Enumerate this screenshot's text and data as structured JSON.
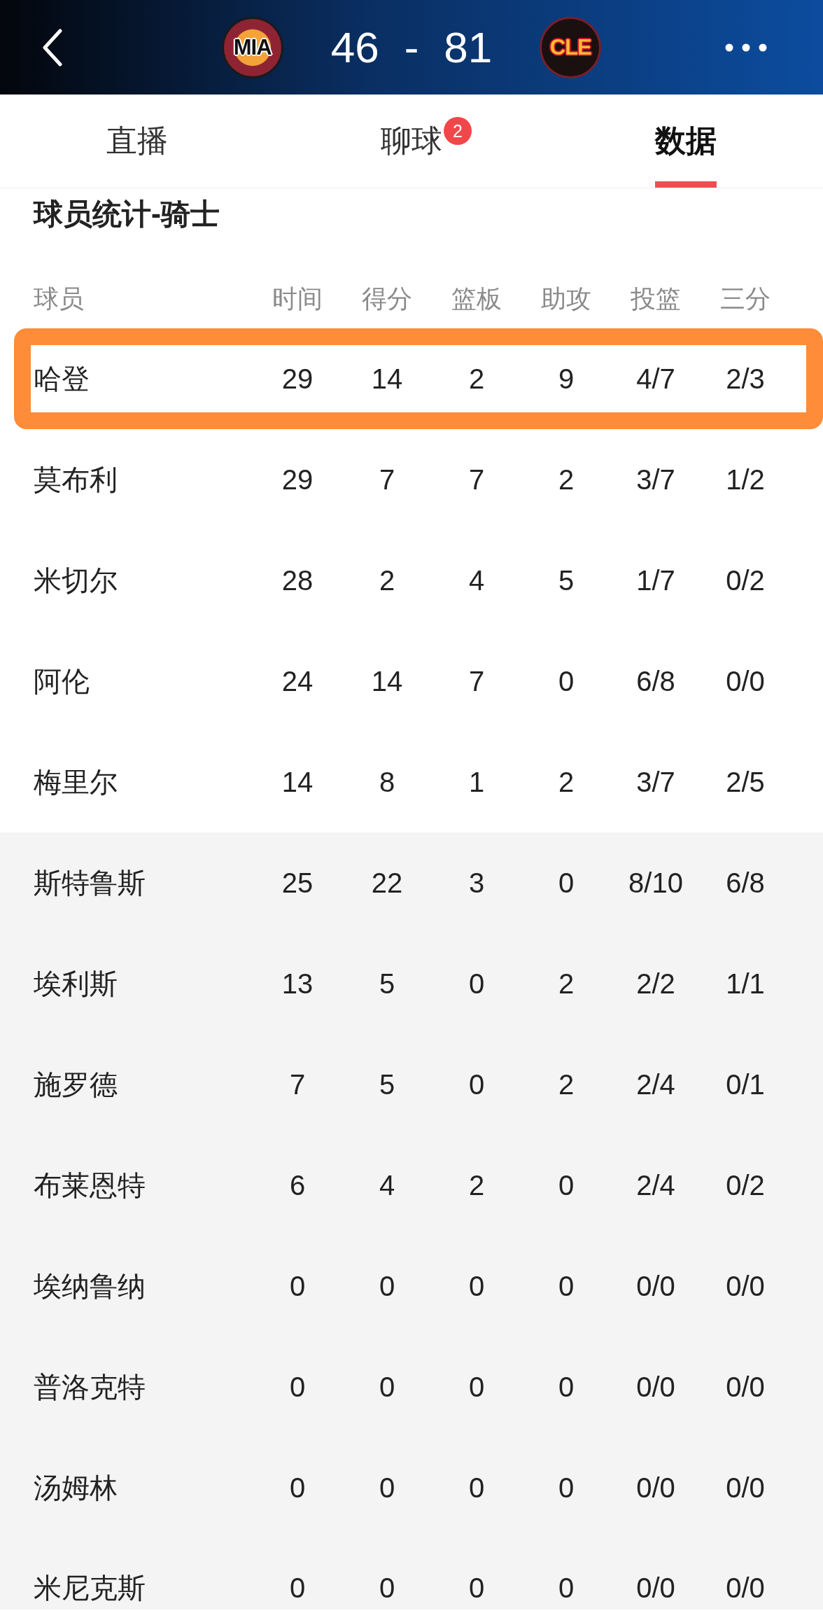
{
  "header": {
    "home": {
      "abbr": "MIA"
    },
    "score": {
      "home": "46",
      "separator": "-",
      "away": "81"
    },
    "away": {
      "abbr": "CLE"
    }
  },
  "tabs": [
    {
      "label": "直播",
      "selected": false
    },
    {
      "label": "聊球",
      "selected": false,
      "badge": "2"
    },
    {
      "label": "数据",
      "selected": true
    }
  ],
  "section": {
    "title": "球员统计-骑士"
  },
  "table": {
    "columns": [
      "球员",
      "时间",
      "得分",
      "篮板",
      "助攻",
      "投篮",
      "三分"
    ],
    "groups": [
      {
        "kind": "starters",
        "rows": [
          {
            "name": "哈登",
            "stats": [
              "29",
              "14",
              "2",
              "9",
              "4/7",
              "2/3"
            ],
            "highlighted": true
          },
          {
            "name": "莫布利",
            "stats": [
              "29",
              "7",
              "7",
              "2",
              "3/7",
              "1/2"
            ],
            "highlighted": false
          },
          {
            "name": "米切尔",
            "stats": [
              "28",
              "2",
              "4",
              "5",
              "1/7",
              "0/2"
            ],
            "highlighted": false
          },
          {
            "name": "阿伦",
            "stats": [
              "24",
              "14",
              "7",
              "0",
              "6/8",
              "0/0"
            ],
            "highlighted": false
          },
          {
            "name": "梅里尔",
            "stats": [
              "14",
              "8",
              "1",
              "2",
              "3/7",
              "2/5"
            ],
            "highlighted": false
          }
        ]
      },
      {
        "kind": "bench",
        "rows": [
          {
            "name": "斯特鲁斯",
            "stats": [
              "25",
              "22",
              "3",
              "0",
              "8/10",
              "6/8"
            ],
            "highlighted": false
          },
          {
            "name": "埃利斯",
            "stats": [
              "13",
              "5",
              "0",
              "2",
              "2/2",
              "1/1"
            ],
            "highlighted": false
          },
          {
            "name": "施罗德",
            "stats": [
              "7",
              "5",
              "0",
              "2",
              "2/4",
              "0/1"
            ],
            "highlighted": false
          },
          {
            "name": "布莱恩特",
            "stats": [
              "6",
              "4",
              "2",
              "0",
              "2/4",
              "0/2"
            ],
            "highlighted": false
          },
          {
            "name": "埃纳鲁纳",
            "stats": [
              "0",
              "0",
              "0",
              "0",
              "0/0",
              "0/0"
            ],
            "highlighted": false
          },
          {
            "name": "普洛克特",
            "stats": [
              "0",
              "0",
              "0",
              "0",
              "0/0",
              "0/0"
            ],
            "highlighted": false
          },
          {
            "name": "汤姆林",
            "stats": [
              "0",
              "0",
              "0",
              "0",
              "0/0",
              "0/0"
            ],
            "highlighted": false
          },
          {
            "name": "米尼克斯",
            "stats": [
              "0",
              "0",
              "0",
              "0",
              "0/0",
              "0/0"
            ],
            "highlighted": false
          }
        ]
      }
    ]
  }
}
